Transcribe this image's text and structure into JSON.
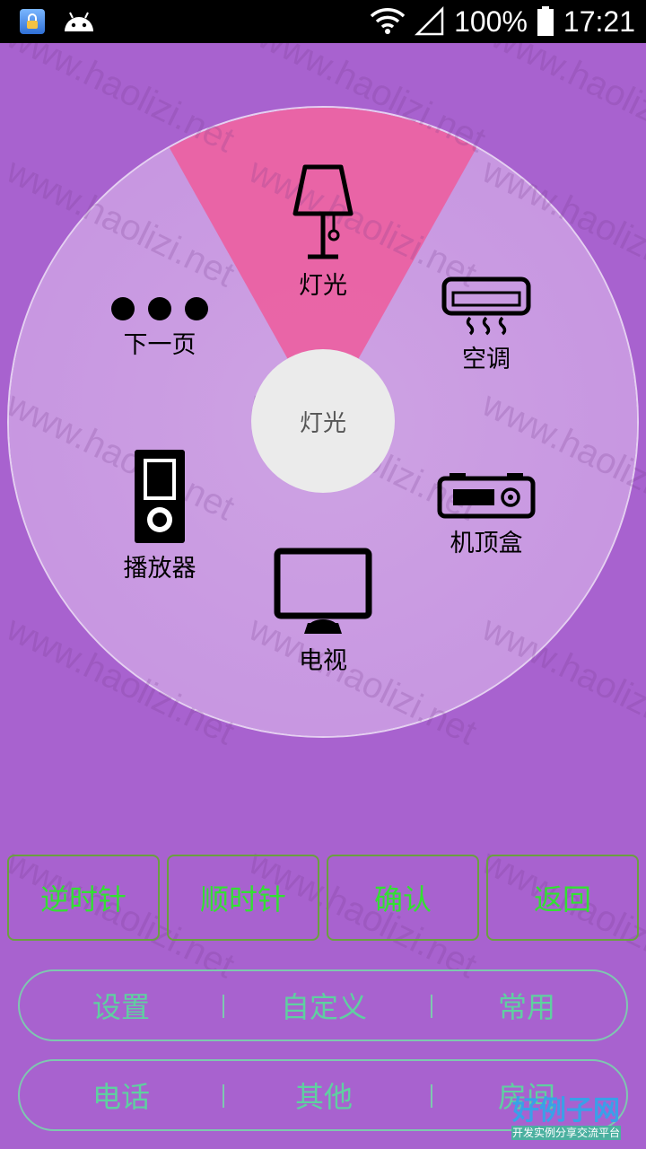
{
  "status_bar": {
    "battery": "100%",
    "time": "17:21"
  },
  "watermark": "www.haolizi.net",
  "wheel": {
    "center_label": "灯光",
    "items": [
      {
        "label": "灯光",
        "icon": "lamp-icon"
      },
      {
        "label": "空调",
        "icon": "air-conditioner-icon"
      },
      {
        "label": "机顶盒",
        "icon": "set-top-box-icon"
      },
      {
        "label": "电视",
        "icon": "tv-icon"
      },
      {
        "label": "播放器",
        "icon": "media-player-icon"
      },
      {
        "label": "下一页",
        "icon": "more-dots-icon"
      }
    ],
    "highlight_color": "#ec5ea0"
  },
  "controls": {
    "counterclockwise": "逆时针",
    "clockwise": "顺时针",
    "confirm": "确认",
    "back": "返回"
  },
  "tabs_row1": [
    "设置",
    "自定义",
    "常用"
  ],
  "tabs_row2": [
    "电话",
    "其他",
    "房间"
  ],
  "logo": {
    "main": "好例子网",
    "sub": "开发实例分享交流平台"
  }
}
